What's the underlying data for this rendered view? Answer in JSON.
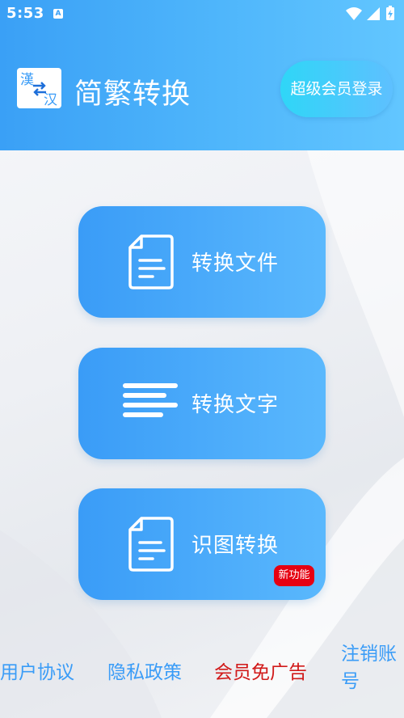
{
  "status_bar": {
    "time": "5:53",
    "notif_letter": "A",
    "icons": [
      "wifi-icon",
      "signal-icon",
      "battery-icon"
    ]
  },
  "header": {
    "app_title": "简繁转换",
    "logo_top": "漢",
    "logo_bottom": "汉",
    "vip_login": "超级会员登录"
  },
  "menu": [
    {
      "label": "转换文件",
      "icon": "file-icon"
    },
    {
      "label": "转换文字",
      "icon": "text-lines-icon"
    },
    {
      "label": "识图转换",
      "icon": "file-icon",
      "badge": "新功能"
    }
  ],
  "footer": {
    "user_agreement": "用户协议",
    "privacy_policy": "隐私政策",
    "vip_ad_free": "会员免广告",
    "delete_account_line1": "注销账",
    "delete_account_line2": "号"
  },
  "colors": {
    "header": "#4fb6fb",
    "card": "#4aaaf9",
    "link": "#3a9cf7",
    "highlight_link": "#d11a1a",
    "badge": "#e60012"
  }
}
